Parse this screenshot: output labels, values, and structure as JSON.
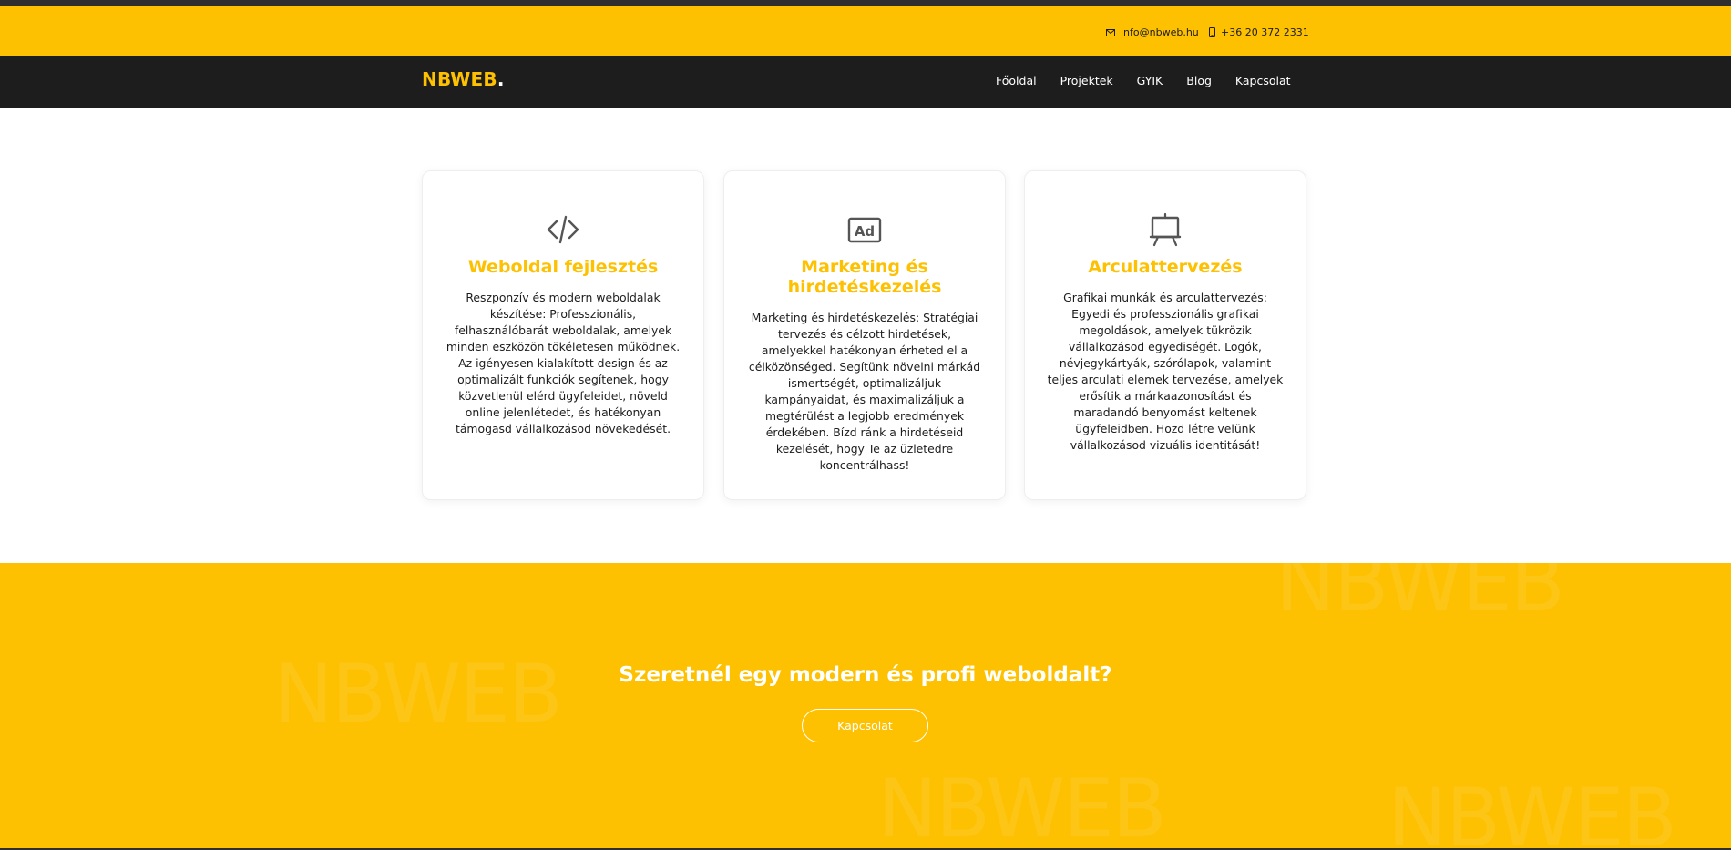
{
  "topbar": {
    "email": "info@nbweb.hu",
    "phone": "+36 20 372 2331",
    "email_icon": "mail-icon",
    "phone_icon": "phone-icon"
  },
  "brand": {
    "name": "NBWEB",
    "dot": "."
  },
  "nav": {
    "items": [
      "Főoldal",
      "Projektek",
      "GYIK",
      "Blog",
      "Kapcsolat"
    ]
  },
  "services": [
    {
      "icon": "code-icon",
      "title": "Weboldal fejlesztés",
      "text": "Reszponzív és modern weboldalak készítése: Professzionális, felhasználóbarát weboldalak, amelyek minden eszközön tökéletesen működnek. Az igényesen kialakított design és az optimalizált funkciók segítenek, hogy közvetlenül elérd ügyfeleidet, növeld online jelenlétedet, és hatékonyan támogasd vállalkozásod növekedését."
    },
    {
      "icon": "ad-icon",
      "title": "Marketing és hirdetéskezelés",
      "text": "Marketing és hirdetéskezelés: Stratégiai tervezés és célzott hirdetések, amelyekkel hatékonyan érheted el a célközönséged. Segítünk növelni márkád ismertségét, optimalizáljuk kampányaidat, és maximalizáljuk a megtérülést a legjobb eredmények érdekében. Bízd ránk a hirdetéseid kezelését, hogy Te az üzletedre koncentrálhass!"
    },
    {
      "icon": "easel-icon",
      "title": "Arculattervezés",
      "text": "Grafikai munkák és arculattervezés: Egyedi és professzionális grafikai megoldások, amelyek tükrözik vállalkozásod egyediségét. Logók, névjegykártyák, szórólapok, valamint teljes arculati elemek tervezése, amelyek erősítik a márkaazonosítást és maradandó benyomást keltenek ügyfeleidben. Hozd létre velünk vállalkozásod vizuális identitását!"
    }
  ],
  "cta": {
    "heading": "Szeretnél egy modern és profi weboldalt?",
    "button": "Kapcsolat",
    "watermark": "NBWEB"
  },
  "colors": {
    "accent": "#fdc102",
    "dark": "#1d1d1d",
    "white": "#ffffff"
  }
}
